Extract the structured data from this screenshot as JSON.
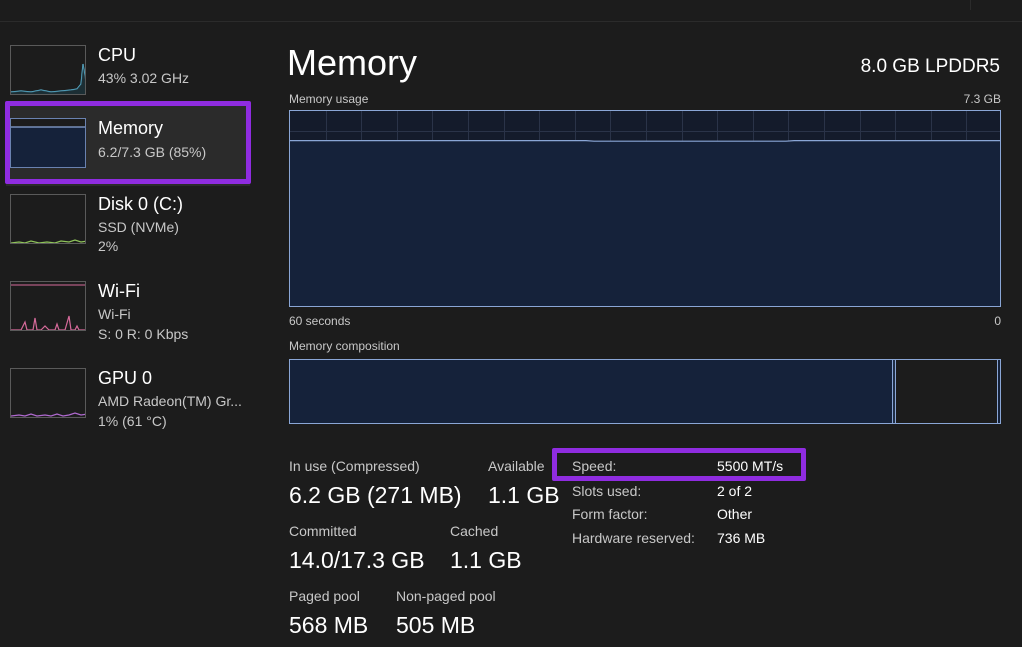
{
  "sidebar": {
    "items": [
      {
        "title": "CPU",
        "sub1": "43%  3.02 GHz",
        "sub2": "",
        "color": "#5fb8d8"
      },
      {
        "title": "Memory",
        "sub1": "6.2/7.3 GB (85%)",
        "sub2": "",
        "color": "#8aa6d6"
      },
      {
        "title": "Disk 0 (C:)",
        "sub1": "SSD (NVMe)",
        "sub2": "2%",
        "color": "#8fc45a"
      },
      {
        "title": "Wi-Fi",
        "sub1": "Wi-Fi",
        "sub2": "S: 0 R: 0 Kbps",
        "color": "#d66a9a"
      },
      {
        "title": "GPU 0",
        "sub1": "AMD Radeon(TM) Gr...",
        "sub2": "1% (61 °C)",
        "color": "#b06ad0"
      }
    ],
    "selected": "Memory"
  },
  "main": {
    "title": "Memory",
    "spec": "8.0 GB LPDDR5",
    "usage_label": "Memory usage",
    "usage_max": "7.3 GB",
    "time_left": "60 seconds",
    "time_right": "0",
    "usage_fraction": 0.85,
    "composition_label": "Memory composition"
  },
  "stats": {
    "in_use_label": "In use (Compressed)",
    "in_use_value": "6.2 GB (271 MB)",
    "available_label": "Available",
    "available_value": "1.1 GB",
    "committed_label": "Committed",
    "committed_value": "14.0/17.3 GB",
    "cached_label": "Cached",
    "cached_value": "1.1 GB",
    "paged_label": "Paged pool",
    "paged_value": "568 MB",
    "nonpaged_label": "Non-paged pool",
    "nonpaged_value": "505 MB"
  },
  "specs": [
    {
      "key": "Speed:",
      "value": "5500 MT/s"
    },
    {
      "key": "Slots used:",
      "value": "2 of 2"
    },
    {
      "key": "Form factor:",
      "value": "Other"
    },
    {
      "key": "Hardware reserved:",
      "value": "736 MB"
    }
  ],
  "colors": {
    "accent_highlight": "#8f2ce0",
    "memory_line": "#8aa6d6",
    "memory_fill": "#15223a",
    "background": "#1c1c1c"
  }
}
